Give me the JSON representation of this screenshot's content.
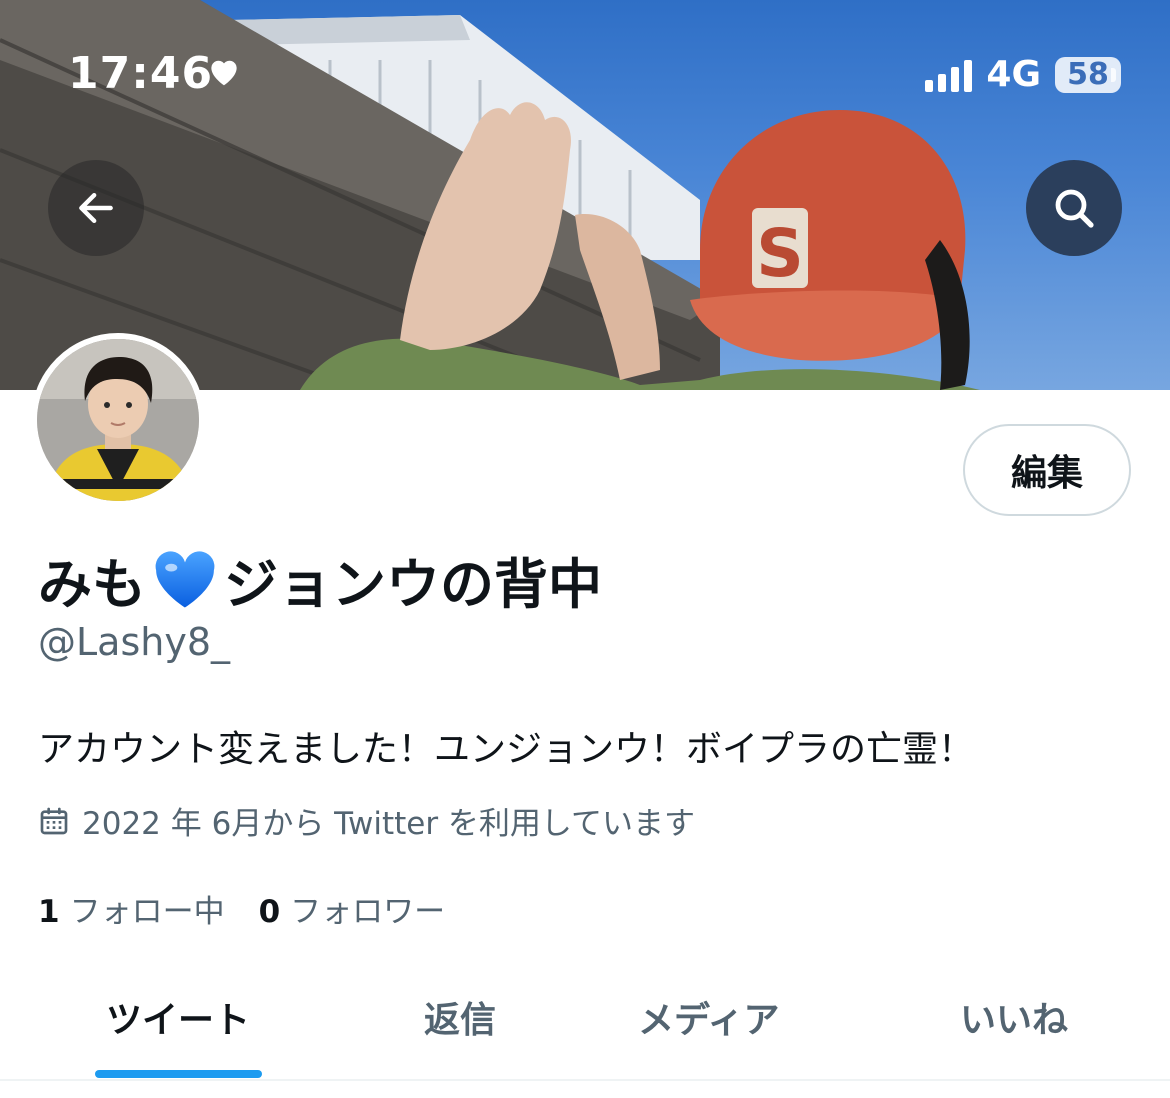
{
  "status_bar": {
    "time": "17:46",
    "network": "4G",
    "battery": "58"
  },
  "header": {
    "back_icon": "arrow-left-icon",
    "search_icon": "search-icon"
  },
  "profile": {
    "edit_label": "編集",
    "name_part1": "みも",
    "name_emoji": "blue-heart-emoji",
    "name_part2": "ジョンウの背中",
    "handle": "@Lashy8_",
    "bio": "アカウント変えました！ユンジョンウ！ボイプラの亡霊！",
    "joined": "2022 年 6月から Twitter を利用しています",
    "following_count": "1",
    "following_label": "フォロー中",
    "followers_count": "0",
    "followers_label": "フォロワー"
  },
  "tabs": [
    {
      "label": "ツイート",
      "active": true
    },
    {
      "label": "返信",
      "active": false
    },
    {
      "label": "メディア",
      "active": false
    },
    {
      "label": "いいね",
      "active": false
    }
  ],
  "colors": {
    "accent": "#1d9bf0",
    "text": "#0f1419",
    "muted": "#536471"
  }
}
